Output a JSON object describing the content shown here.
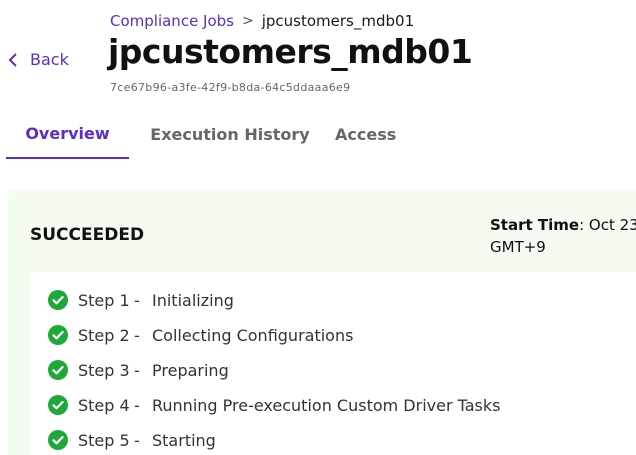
{
  "header": {
    "back_label": "Back",
    "breadcrumb": {
      "parent": "Compliance Jobs",
      "separator": ">",
      "current": "jpcustomers_mdb01"
    },
    "title": "jpcustomers_mdb01",
    "job_id": "7ce67b96-a3fe-42f9-b8da-64c5ddaaa6e9"
  },
  "tabs": [
    {
      "label": "Overview",
      "active": true
    },
    {
      "label": "Execution History",
      "active": false
    },
    {
      "label": "Access",
      "active": false
    }
  ],
  "status": {
    "label": "SUCCEEDED",
    "start_time_label": "Start Time",
    "start_time_value": ": Oct 23,",
    "start_time_tz": "GMT+9"
  },
  "steps": [
    {
      "num": "Step 1",
      "sep": "-",
      "name": "Initializing",
      "icon": "check-circle-icon"
    },
    {
      "num": "Step 2",
      "sep": "-",
      "name": "Collecting Configurations",
      "icon": "check-circle-icon"
    },
    {
      "num": "Step 3",
      "sep": "-",
      "name": "Preparing",
      "icon": "check-circle-icon"
    },
    {
      "num": "Step 4",
      "sep": "-",
      "name": "Running Pre-execution Custom Driver Tasks",
      "icon": "check-circle-icon"
    },
    {
      "num": "Step 5",
      "sep": "-",
      "name": "Starting",
      "icon": "check-circle-icon"
    }
  ],
  "colors": {
    "accent": "#5a2dc8",
    "success": "#1fa83a",
    "panel_bg": "#f4fbf1"
  }
}
